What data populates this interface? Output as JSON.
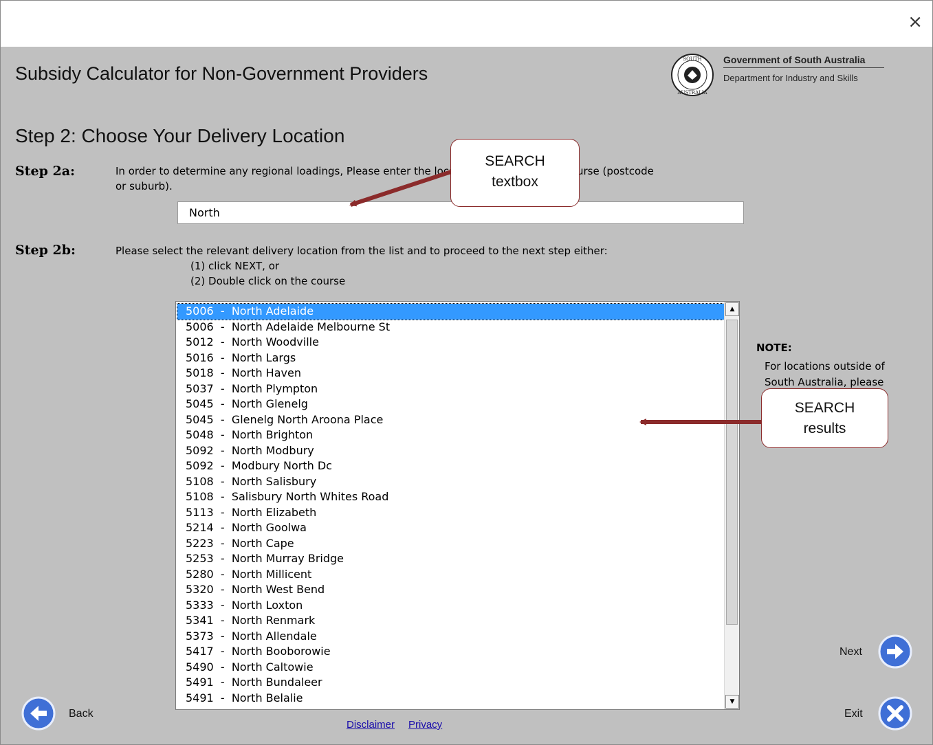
{
  "window": {
    "close_glyph": "×",
    "close_icon": "close-icon"
  },
  "header": {
    "app_title": "Subsidy Calculator for Non-Government Providers",
    "gov_name": "Government of South Australia",
    "gov_dept": "Department for Industry and Skills",
    "logo_icon": "south-australia-crest-icon"
  },
  "step": {
    "title": "Step 2: Choose Your Delivery Location",
    "a_label": "Step 2a:",
    "a_line1": "In order to determine any regional loadings, Please enter the location of your selected course (postcode",
    "a_line2": "or suburb).",
    "search_value": "North",
    "b_label": "Step 2b:",
    "b_line1": "Please select the relevant delivery location from the list and to proceed to the next step either:",
    "b_line2": "(1) click NEXT, or",
    "b_line3": "(2) Double click on the course"
  },
  "results": {
    "selected_index": 0,
    "items": [
      "5006  -  North Adelaide",
      "5006  -  North Adelaide Melbourne St",
      "5012  -  North Woodville",
      "5016  -  North Largs",
      "5018  -  North Haven",
      "5037  -  North Plympton",
      "5045  -  North Glenelg",
      "5045  -  Glenelg North Aroona Place",
      "5048  -  North Brighton",
      "5092  -  North Modbury",
      "5092  -  Modbury North Dc",
      "5108  -  North Salisbury",
      "5108  -  Salisbury North Whites Road",
      "5113  -  North Elizabeth",
      "5214  -  North Goolwa",
      "5223  -  North Cape",
      "5253  -  North Murray Bridge",
      "5280  -  North Millicent",
      "5320  -  North West Bend",
      "5333  -  North Loxton",
      "5341  -  North Renmark",
      "5373  -  North Allendale",
      "5417  -  North Booborowie",
      "5490  -  North Caltowie",
      "5491  -  North Bundaleer",
      "5491  -  North Belalie"
    ],
    "scroll_up_glyph": "▲",
    "scroll_down_glyph": "▼"
  },
  "note": {
    "heading": "NOTE:",
    "line1": "For locations outside of",
    "line2": "South Australia, please"
  },
  "callouts": {
    "search_box_line1": "SEARCH",
    "search_box_line2": "textbox",
    "results_line1": "SEARCH",
    "results_line2": "results",
    "color": "#8b2b2b"
  },
  "nav": {
    "next_label": "Next",
    "exit_label": "Exit",
    "back_label": "Back",
    "next_icon": "arrow-right-icon",
    "exit_icon": "x-icon",
    "back_icon": "arrow-left-icon",
    "button_color": "#3f6fd6"
  },
  "footer": {
    "disclaimer": "Disclaimer",
    "privacy": "Privacy"
  },
  "colors": {
    "background": "#c0c0c0",
    "selection": "#3399ff",
    "link": "#1a0dab"
  }
}
